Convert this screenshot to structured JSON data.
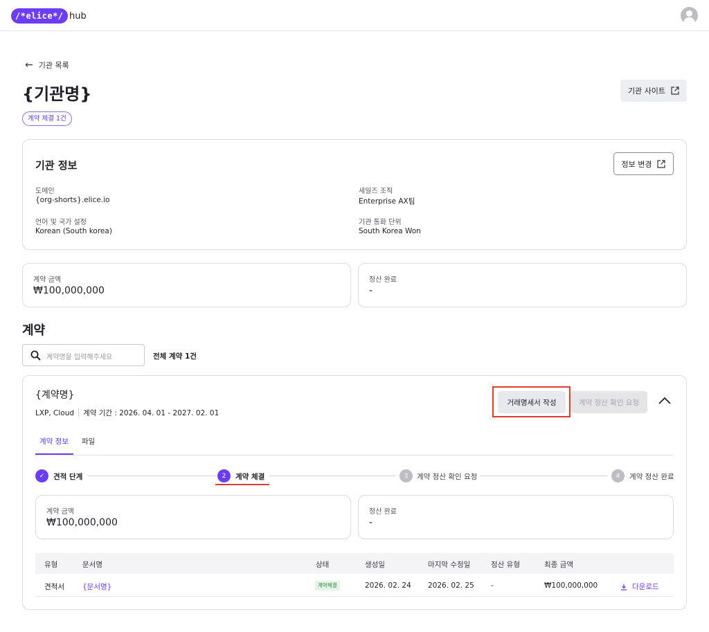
{
  "header": {
    "logo_text": "/*elice*/",
    "logo_suffix": "hub"
  },
  "nav": {
    "back_label": "기관 목록"
  },
  "org": {
    "title": "{기관명}",
    "site_button": "기관 사이트",
    "contract_chip": "계약 체결 1건"
  },
  "info": {
    "heading": "기관 정보",
    "edit_button": "정보 변경",
    "fields": {
      "domain_label": "도메인",
      "domain_value": "{org-shorts}.elice.io",
      "sales_label": "세일즈 조직",
      "sales_value": "Enterprise AX팀",
      "lang_label": "언어 및 국가 설정",
      "lang_value": "Korean (South korea)",
      "currency_label": "기관 통화 단위",
      "currency_value": "South Korea Won"
    }
  },
  "summary": {
    "amount_label": "계약 금액",
    "amount_value": "₩100,000,000",
    "settle_label": "정산 완료",
    "settle_value": "-"
  },
  "contracts": {
    "heading": "계약",
    "search_placeholder": "계약명을 입력해주세요",
    "total_label": "전체 계약 1건",
    "item": {
      "name": "{계약명}",
      "products": "LXP, Cloud",
      "period": "계약 기간 : 2026. 04. 01 - 2027. 02. 01",
      "invoice_button": "거래명세서 작성",
      "settle_request_button": "계약 정산 확인 요청",
      "tabs": [
        "계약 정보",
        "파일"
      ],
      "steps": [
        {
          "num": "✓",
          "label": "견적 단계",
          "state": "done"
        },
        {
          "num": "2",
          "label": "계약 체결",
          "state": "current"
        },
        {
          "num": "3",
          "label": "계약 정산 확인 요청",
          "state": "todo"
        },
        {
          "num": "4",
          "label": "계약 정산 완료",
          "state": "todo"
        }
      ],
      "amount_label": "계약 금액",
      "amount_value": "₩100,000,000",
      "settle_label": "정산 완료",
      "settle_value": "-",
      "table": {
        "headers": [
          "유형",
          "문서명",
          "상태",
          "생성일",
          "마지막 수정일",
          "정산 유형",
          "최종 금액"
        ],
        "rows": [
          {
            "type": "견적서",
            "doc_name": "{문서명}",
            "status": "계약체결",
            "created": "2026. 02. 24",
            "modified": "2026. 02. 25",
            "settle_type": "-",
            "final_amount": "₩100,000,000",
            "download": "다운로드"
          }
        ]
      }
    }
  },
  "colors": {
    "accent": "#6b3ef5",
    "highlight": "#e03b28",
    "status_green_bg": "#e4f4e6",
    "status_green_text": "#2f7d3a"
  }
}
